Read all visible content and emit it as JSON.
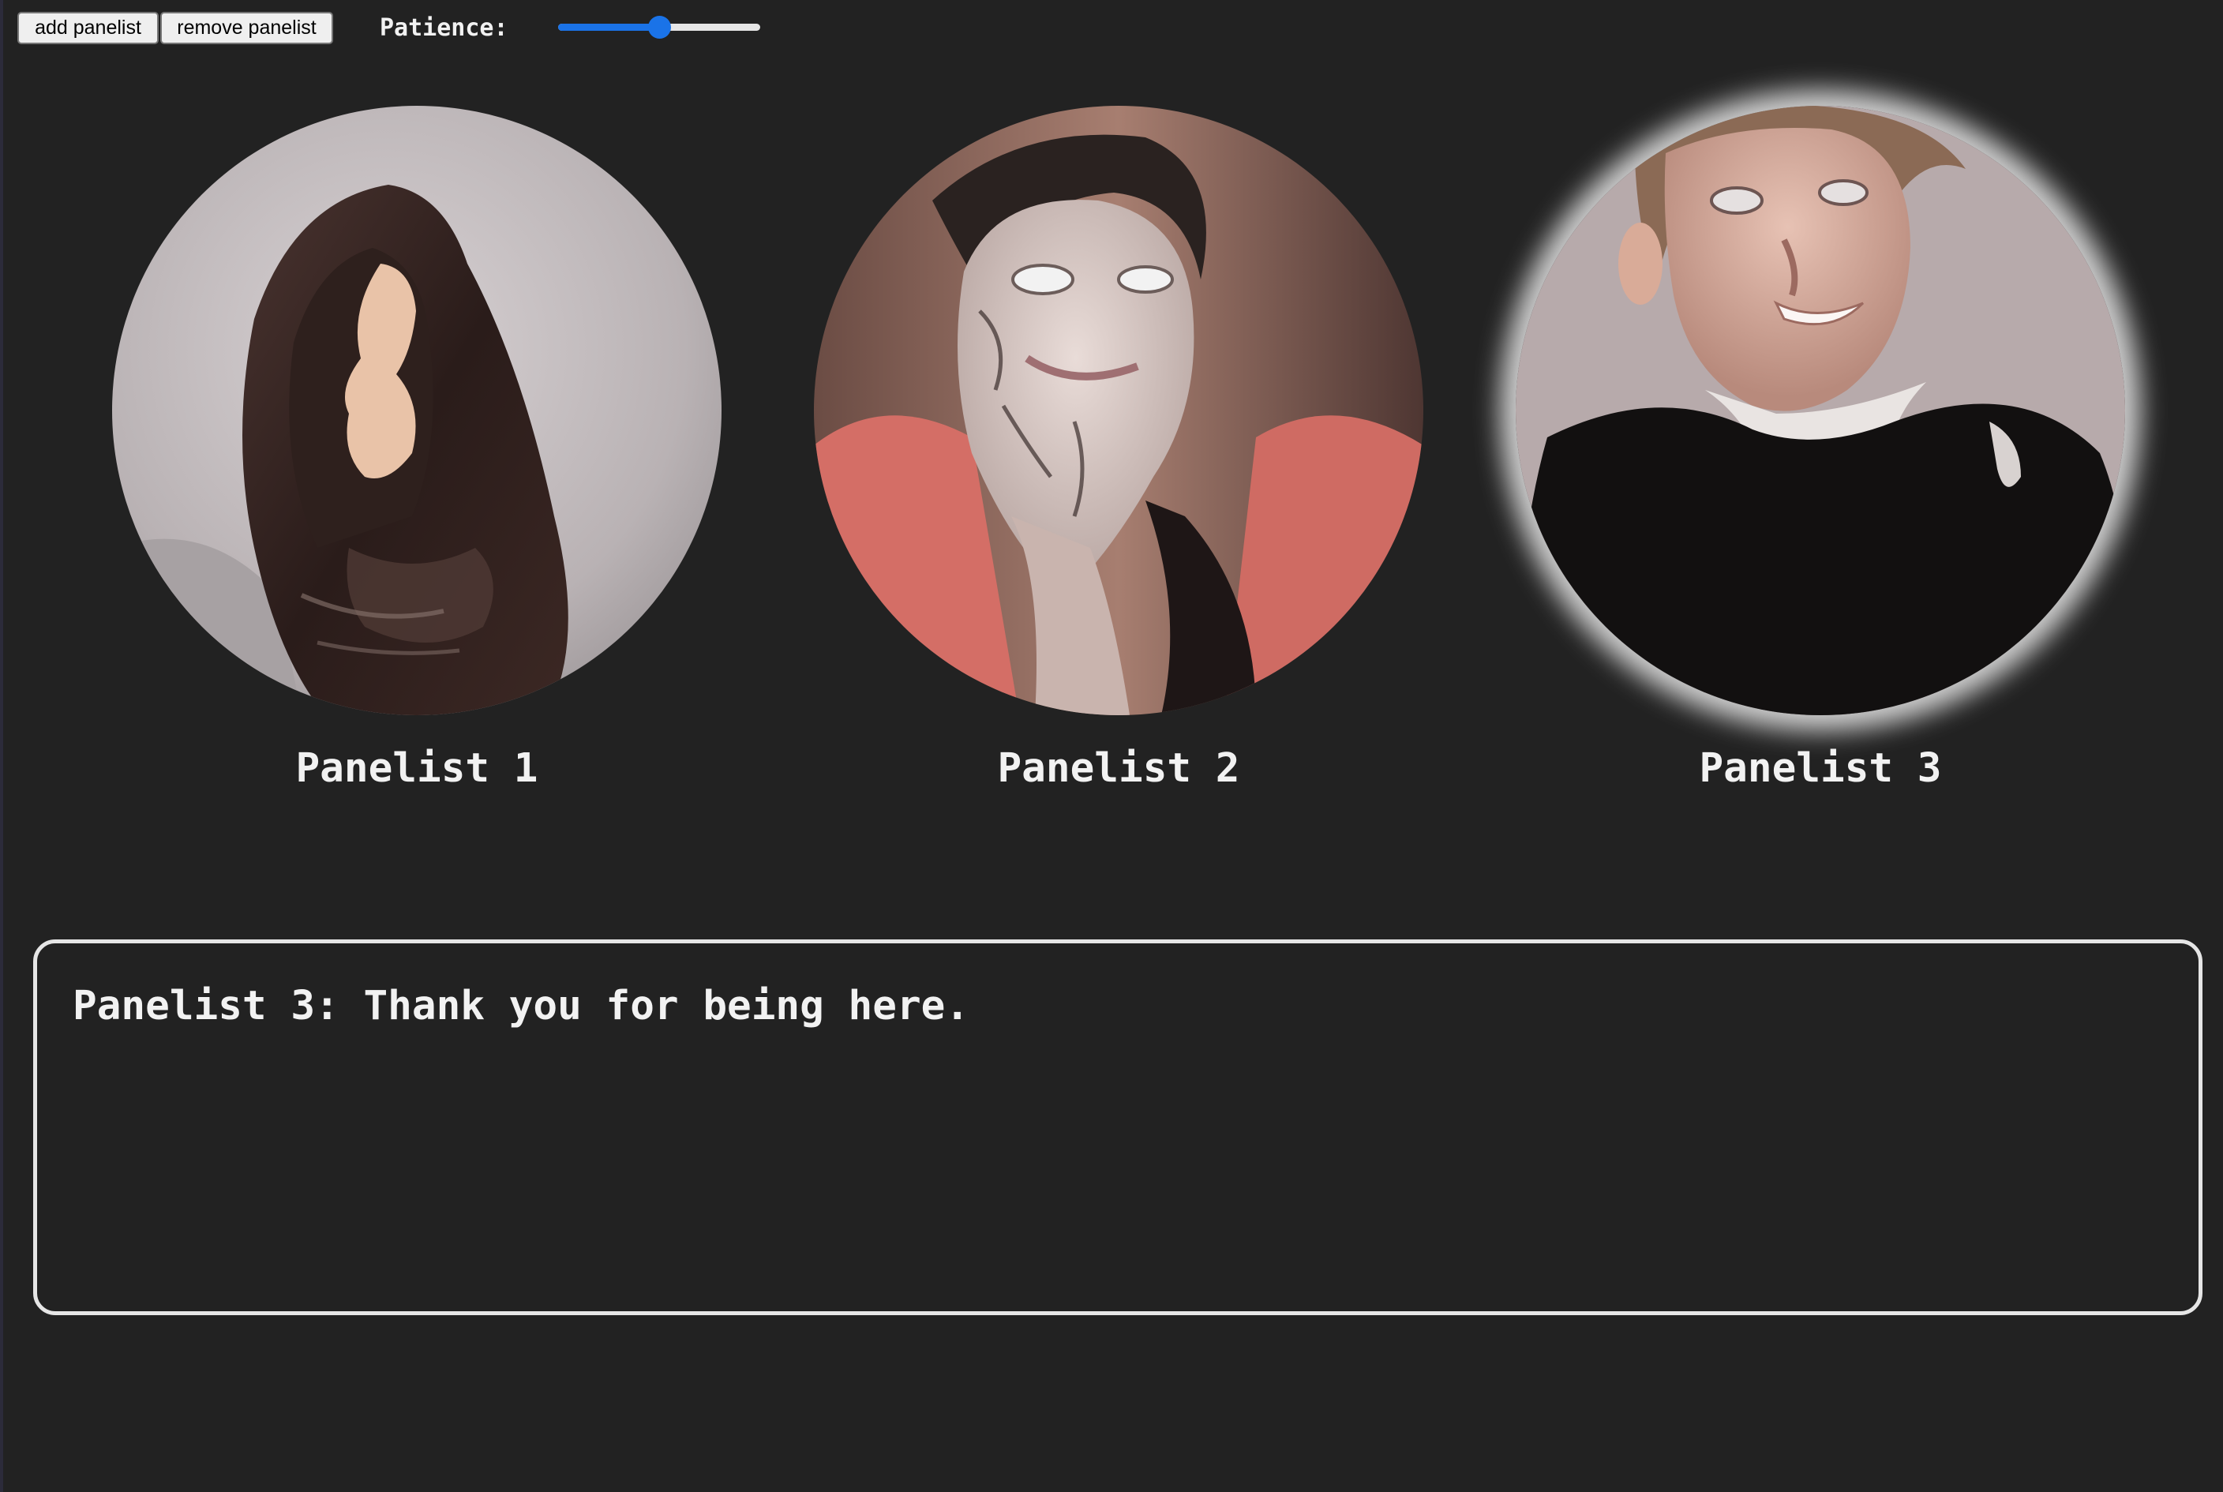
{
  "toolbar": {
    "add_button_label": "add panelist",
    "remove_button_label": "remove panelist",
    "patience_label": "Patience:",
    "patience_value_fraction": 0.5,
    "slider_accent_color": "#1a73e8"
  },
  "panelists": [
    {
      "name": "Panelist 1",
      "speaking": false
    },
    {
      "name": "Panelist 2",
      "speaking": false
    },
    {
      "name": "Panelist 3",
      "speaking": true
    }
  ],
  "transcript": {
    "text": "Panelist 3: Thank you for being here."
  },
  "colors": {
    "background": "#222222",
    "text": "#f2f2f2",
    "transcript_border": "#e6e6e6",
    "speaking_glow": "#ffffff"
  }
}
